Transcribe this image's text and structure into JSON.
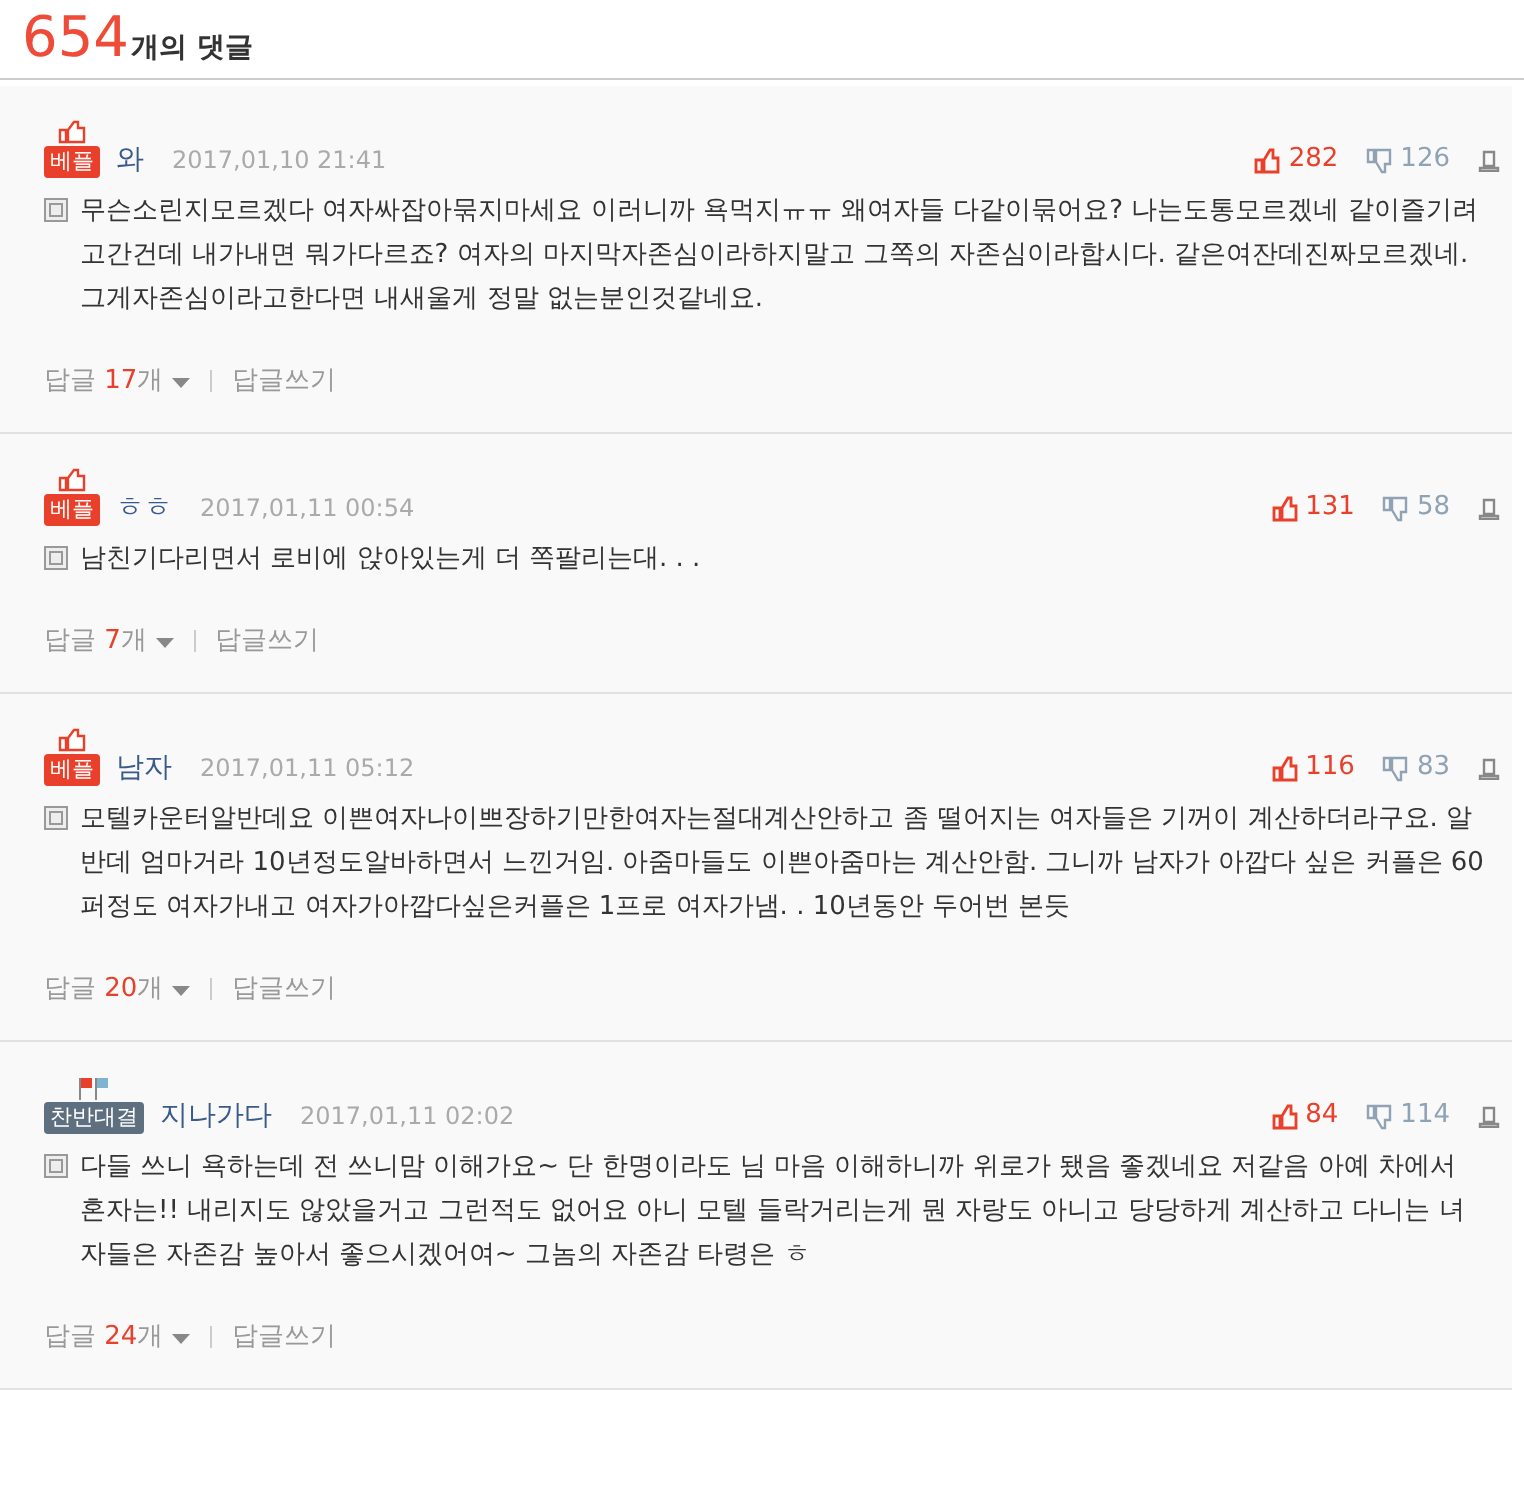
{
  "header": {
    "count": "654",
    "label": "개의 댓글"
  },
  "comments": [
    {
      "badge": {
        "kind": "best",
        "label": "베플"
      },
      "author": "와",
      "date": "2017,01,10 21:41",
      "likes": "282",
      "dislikes": "126",
      "text": "무슨소린지모르겠다 여자싸잡아묶지마세요 이러니까 욕먹지ㅠㅠ 왜여자들 다같이묶어요? 나는도통모르겠네 같이즐기려고간건데 내가내면 뭐가다르죠? 여자의 마지막자존심이라하지말고 그쪽의 자존심이라합시다. 같은여잔데진짜모르겠네. 그게자존심이라고한다면 내새울게 정말 없는분인것같네요.",
      "reply_label": "답글",
      "reply_count": "17",
      "reply_unit": "개",
      "write_label": "답글쓰기"
    },
    {
      "badge": {
        "kind": "best",
        "label": "베플"
      },
      "author": "ㅎㅎ",
      "date": "2017,01,11 00:54",
      "likes": "131",
      "dislikes": "58",
      "text": "남친기다리면서 로비에 앉아있는게 더 쪽팔리는대. . .",
      "reply_label": "답글",
      "reply_count": "7",
      "reply_unit": "개",
      "write_label": "답글쓰기"
    },
    {
      "badge": {
        "kind": "best",
        "label": "베플"
      },
      "author": "남자",
      "date": "2017,01,11 05:12",
      "likes": "116",
      "dislikes": "83",
      "text": "모텔카운터알반데요 이쁜여자나이쁘장하기만한여자는절대계산안하고 좀 떨어지는 여자들은 기꺼이 계산하더라구요. 알반데 엄마거라 10년정도알바하면서 느낀거임. 아줌마들도 이쁜아줌마는 계산안함. 그니까 남자가 아깝다 싶은 커플은 60퍼정도 여자가내고 여자가아깝다싶은커플은 1프로 여자가냄. . 10년동안 두어번 본듯",
      "reply_label": "답글",
      "reply_count": "20",
      "reply_unit": "개",
      "write_label": "답글쓰기"
    },
    {
      "badge": {
        "kind": "versus",
        "label": "찬반대결"
      },
      "author": "지나가다",
      "date": "2017,01,11 02:02",
      "likes": "84",
      "dislikes": "114",
      "text": "다들 쓰니 욕하는데 전 쓰니맘 이해가요~ 단 한명이라도 님 마음 이해하니까 위로가 됐음 좋겠네요 저같음 아예 차에서 혼자는!! 내리지도 않았을거고 그런적도 없어요 아니 모텔 들락거리는게 뭔 자랑도 아니고 당당하게 계산하고 다니는 녀자들은 자존감 높아서 좋으시겠어여~ 그놈의 자존감 타령은 ㅎ",
      "reply_label": "답글",
      "reply_count": "24",
      "reply_unit": "개",
      "write_label": "답글쓰기"
    }
  ]
}
